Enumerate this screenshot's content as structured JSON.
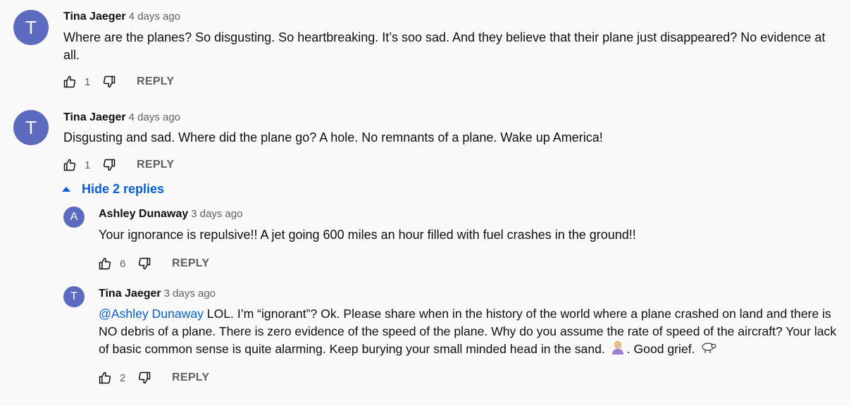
{
  "comments": [
    {
      "avatar_letter": "T",
      "author": "Tina Jaeger",
      "time": "4 days ago",
      "text": "Where are the planes?  So disgusting. So heartbreaking.  It’s soo sad.  And they believe that their plane just disappeared?  No evidence at all.",
      "likes": "1",
      "reply_label": "REPLY"
    },
    {
      "avatar_letter": "T",
      "author": "Tina Jaeger",
      "time": "4 days ago",
      "text": "Disgusting and sad. Where did the plane go?  A hole. No remnants of a plane. Wake up America!",
      "likes": "1",
      "reply_label": "REPLY"
    }
  ],
  "replies_toggle": "Hide 2 replies",
  "replies": [
    {
      "avatar_letter": "A",
      "author": "Ashley Dunaway",
      "time": "3 days ago",
      "text": "Your ignorance is repulsive!!  A jet going 600 miles an hour filled with  fuel  crashes  in the ground!!",
      "likes": "6",
      "reply_label": "REPLY"
    },
    {
      "avatar_letter": "T",
      "author": "Tina Jaeger",
      "time": "3 days ago",
      "mention": "@Ashley Dunaway",
      "text_part1": " LOL.  I’m “ignorant”?  Ok.  Please share when in the history of the world where a plane crashed  on land and there is NO debris of a plane.  There is zero evidence of the speed of the plane.  Why do you assume the rate of speed of the aircraft?  Your lack of basic common sense is quite alarming. Keep burying your small minded head in the sand.",
      "text_part2": ".  Good grief.",
      "emoji_1": "person-facepalming-icon",
      "emoji_2": "sheep-icon",
      "likes": "2",
      "reply_label": "REPLY"
    }
  ],
  "colors": {
    "avatar": "#5c6bc0",
    "link": "#065fd4",
    "meta": "#606060",
    "background": "#f9f9f9"
  }
}
